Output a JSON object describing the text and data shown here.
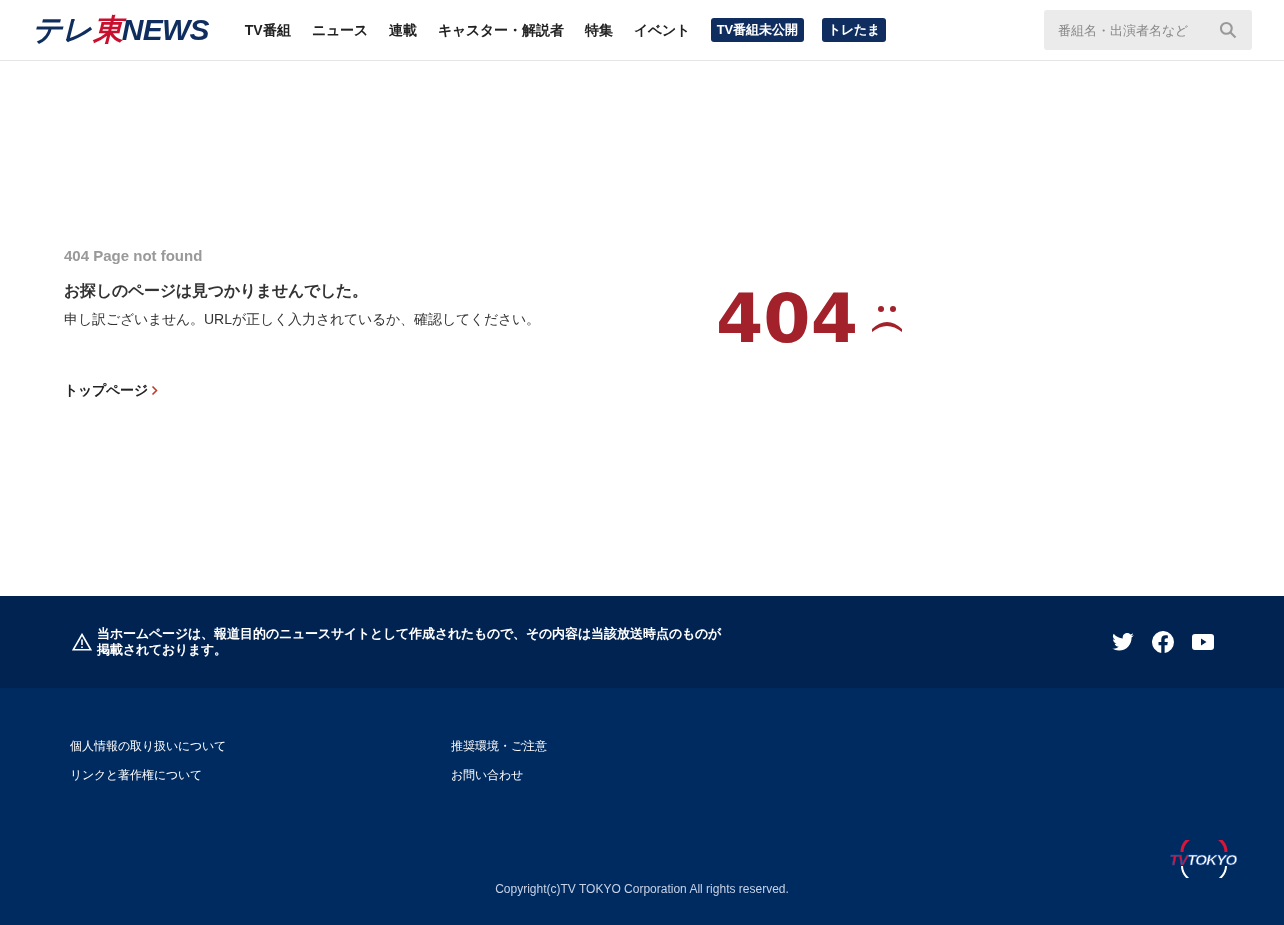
{
  "header": {
    "logo": [
      {
        "text": "テレ",
        "color": "#0f2d5e"
      },
      {
        "text": "東",
        "color": "#c8102e"
      },
      {
        "text": "NEWS",
        "color": "#0f2d5e"
      }
    ],
    "nav": [
      {
        "label": "TV番組",
        "kind": "link"
      },
      {
        "label": "ニュース",
        "kind": "link"
      },
      {
        "label": "連載",
        "kind": "link"
      },
      {
        "label": "キャスター・解説者",
        "kind": "link"
      },
      {
        "label": "特集",
        "kind": "link"
      },
      {
        "label": "イベント",
        "kind": "link"
      },
      {
        "label": "TV番組未公開",
        "kind": "badge"
      },
      {
        "label": "トレたま",
        "kind": "badge"
      }
    ],
    "search": {
      "placeholder": "番組名・出演者名など"
    }
  },
  "error": {
    "label": "404 Page not found",
    "heading": "お探しのページは見つかりませんでした。",
    "message": "申し訳ございません。URLが正しく入力されているか、確認してください。",
    "link": "トップページ",
    "code": "404"
  },
  "notice": {
    "text": "当ホームページは、報道目的のニュースサイトとして作成されたもので、その内容は当該放送時点のものが掲載されております。"
  },
  "footer": {
    "links": [
      [
        "個人情報の取り扱いについて",
        "リンクと著作権について"
      ],
      [
        "推奨環境・ご注意",
        "お問い合わせ"
      ]
    ],
    "brand": [
      {
        "text": "TV",
        "color": "#d7163a"
      },
      {
        "text": "TOKYO",
        "color": "#ffffff"
      }
    ],
    "copyright": "Copyright(c)TV TOKYO Corporation All rights reserved."
  }
}
